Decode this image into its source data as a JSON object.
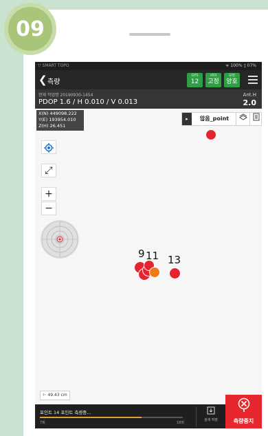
{
  "step": "09",
  "statusbar": {
    "app": "▽ SMART TOPO",
    "right": "ᯤ 100%   ▯ 07%"
  },
  "header": {
    "back": "❮",
    "title": "측량",
    "chips": [
      {
        "key": "GPS",
        "value": "12"
      },
      {
        "key": "VRS",
        "value": "고정"
      },
      {
        "key": "보정",
        "value": "양호"
      }
    ]
  },
  "info": {
    "work": "현재 작업명 20190930-1454",
    "precision": "PDOP 1.6 / H 0.010 / V 0.013",
    "anth_label": "Ant.H",
    "anth_value": "2.0"
  },
  "coords": {
    "x": "X(N) 449098.222",
    "y": "Y(E) 193954.010",
    "z": "Z(H) 26.451"
  },
  "point_bar": {
    "arrow": "▸",
    "name": "않음_point"
  },
  "tools": {
    "locate": "◎",
    "fit": "⤢",
    "zoom_in": "+",
    "zoom_out": "−"
  },
  "markers": [
    {
      "label": "9",
      "color": "#e52430"
    },
    {
      "label": "11",
      "color": "#e52430"
    },
    {
      "label": "13",
      "color": "#e52430"
    }
  ],
  "scale": "⊢ 49.43 cm",
  "bottom": {
    "progress_text": "포인트 14 포인트 측량중...",
    "progress_start": "7회",
    "progress_end": "18회",
    "progress_fraction": 0.71,
    "grid_label": "검색 저장",
    "stop_label": "측량중지"
  },
  "colors": {
    "accent_green": "#2f9e44",
    "marker_red": "#e52430",
    "stop_red": "#e8262d"
  }
}
